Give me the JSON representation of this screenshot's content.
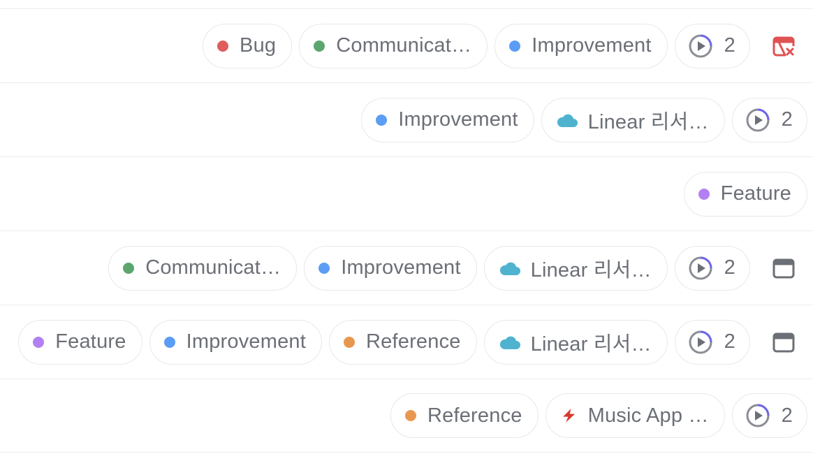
{
  "colors": {
    "bug": "#e05d5d",
    "communication": "#5ba66f",
    "improvement": "#5b9df5",
    "feature": "#b280f2",
    "reference": "#e8984e",
    "cloud": "#4fb3cf",
    "bolt": "#d63a2c",
    "cal_overdue": "#e05252",
    "cal_normal": "#6b6f76"
  },
  "rows": [
    {
      "labels": {
        "bug": "Bug",
        "communication": "Communicat…",
        "improvement": "Improvement"
      },
      "cycle": {
        "count": "2"
      },
      "date_icon": "calendar-overdue-icon"
    },
    {
      "labels": {
        "improvement": "Improvement",
        "project": "Linear 리서…"
      },
      "cycle": {
        "count": "2"
      }
    },
    {
      "labels": {
        "feature": "Feature"
      }
    },
    {
      "labels": {
        "communication": "Communicat…",
        "improvement": "Improvement",
        "project": "Linear 리서…"
      },
      "cycle": {
        "count": "2"
      },
      "date_icon": "calendar-icon"
    },
    {
      "labels": {
        "feature": "Feature",
        "improvement": "Improvement",
        "reference": "Reference",
        "project": "Linear 리서…"
      },
      "cycle": {
        "count": "2"
      },
      "date_icon": "calendar-icon"
    },
    {
      "labels": {
        "reference": "Reference",
        "project": "Music App …"
      },
      "cycle": {
        "count": "2"
      }
    }
  ]
}
